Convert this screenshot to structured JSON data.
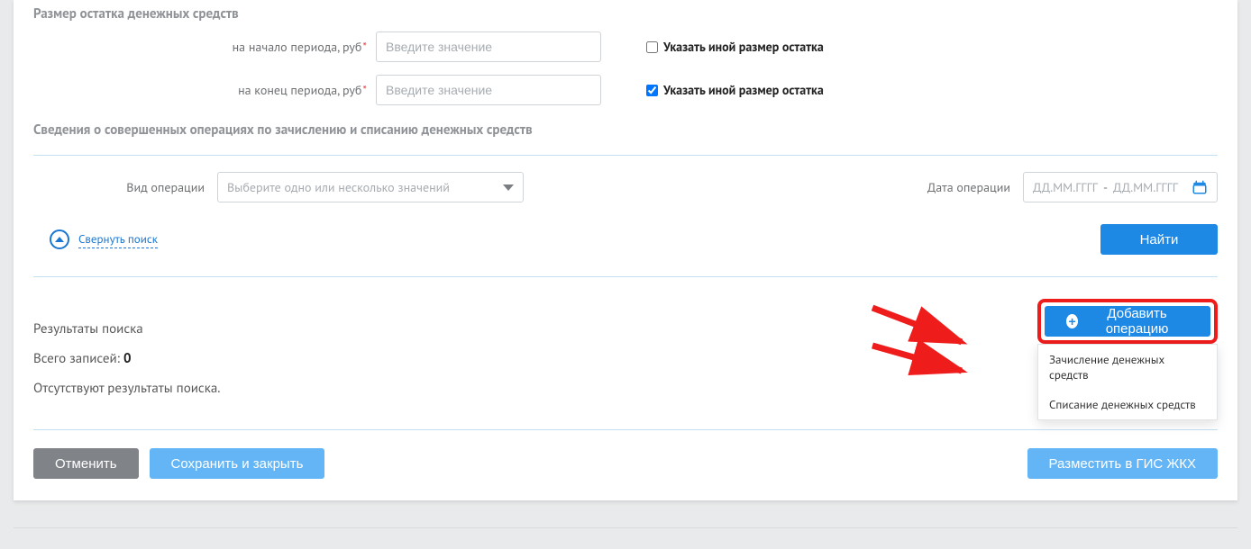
{
  "section1": {
    "heading": "Размер остатка денежных средств",
    "begin": {
      "label": "на начало периода, руб",
      "placeholder": "Введите значение"
    },
    "end": {
      "label": "на конец периода, руб",
      "placeholder": "Введите значение"
    },
    "chk_label": "Указать иной размер остатка"
  },
  "section2": {
    "heading": "Сведения о совершенных операциях по зачислению и списанию денежных средств",
    "op_type_label": "Вид операции",
    "op_type_placeholder": "Выберите одно или несколько значений",
    "op_date_label": "Дата операции",
    "date_placeholder_from": "ДД.ММ.ГГГГ",
    "date_placeholder_to": "ДД.ММ.ГГГГ",
    "collapse_label": "Свернуть поиск",
    "find_label": "Найти"
  },
  "results": {
    "heading": "Результаты поиска",
    "total_prefix": "Всего записей: ",
    "total_count": "0",
    "empty_msg": "Отсутствуют результаты поиска."
  },
  "add_op": {
    "button": "Добавить операцию",
    "menu": [
      "Зачисление денежных средств",
      "Списание денежных средств"
    ]
  },
  "footer": {
    "cancel": "Отменить",
    "save_close": "Сохранить и закрыть",
    "publish": "Разместить в ГИС ЖКХ"
  }
}
